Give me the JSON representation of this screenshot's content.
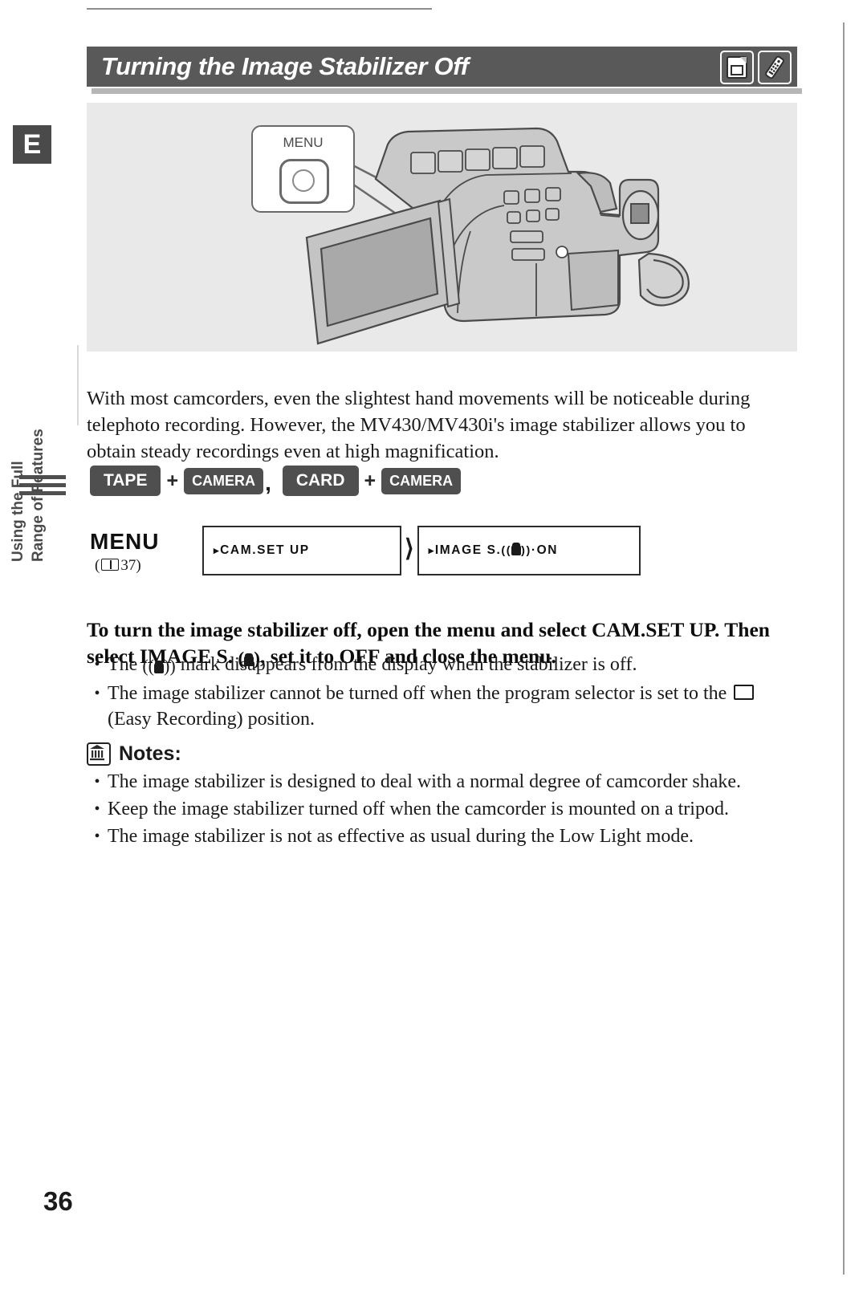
{
  "page": {
    "number": "36",
    "language_badge": "E"
  },
  "side_tab": {
    "line1": "Using the Full",
    "line2": "Range of Features"
  },
  "header": {
    "title": "Turning the Image Stabilizer Off",
    "icons": [
      {
        "name": "card-icon",
        "label": "card"
      },
      {
        "name": "remote-control-icon",
        "label": "remote"
      }
    ]
  },
  "illustration": {
    "callout_label": "MENU",
    "subject": "camcorder with open LCD panel"
  },
  "intro": "With most camcorders, even the slightest hand movements will be noticeable during telephoto recording. However, the MV430/MV430i's image stabilizer allows you to obtain steady recordings even at high magnification.",
  "modes": {
    "tape": "TAPE",
    "camera_1": "CAMERA",
    "card": "CARD",
    "camera_2": "CAMERA",
    "plus": "+",
    "comma": ","
  },
  "menu_flow": {
    "menu_word": "MENU",
    "reference_open": "(",
    "reference_page": "37",
    "reference_close": ")",
    "step1": "CAM.SET UP",
    "step2_prefix": "IMAGE S. ",
    "step2_suffix": "·ON",
    "cursor": "▸"
  },
  "instruction": "To turn the image stabilizer off, open the menu and select CAM.SET UP. Then select IMAGE S. (), set it to OFF and close the menu.",
  "instruction_parts": {
    "a": "To turn the image stabilizer off, open the menu and select CAM.SET UP. Then select IMAGE S. ",
    "b": ", set it to OFF and close the menu."
  },
  "bullets_main": [
    {
      "a": "The ",
      "b": " mark disappears from the display when the stabilizer is off.",
      "has_hand": true
    },
    {
      "a": "The image stabilizer cannot be turned off when the program selector is set to the ",
      "b": " (Easy Recording) position.",
      "has_square": true
    }
  ],
  "notes": {
    "title": "Notes:",
    "icon": "notes-book-icon",
    "items": [
      "The image stabilizer is designed to deal with a normal degree of camcorder shake.",
      "Keep the image stabilizer turned off when the camcorder is mounted on a tripod.",
      "The image stabilizer is not as effective as usual during the Low Light mode."
    ]
  },
  "bullet_marker": "•",
  "colors": {
    "header_bar": "#595959",
    "illustration_bg": "#e9e9e9",
    "chip": "#4f4f4f",
    "text": "#1a1a1a"
  }
}
